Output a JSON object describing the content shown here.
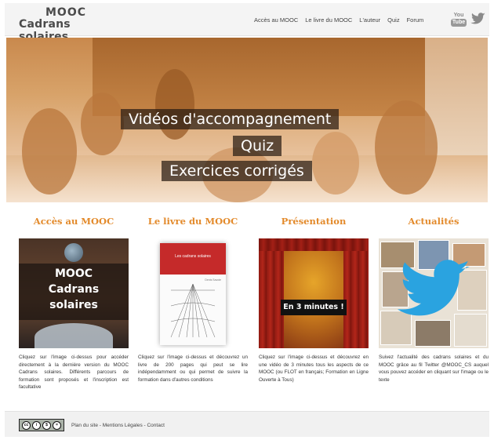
{
  "header": {
    "logo_top": "MOOC",
    "logo_name": "Cadrans solaires",
    "nav": [
      "Accès au MOOC",
      "Le livre du MOOC",
      "L'auteur",
      "Quiz",
      "Forum"
    ],
    "youtube_you": "You",
    "youtube_tube": "Tube"
  },
  "hero": {
    "lines": [
      "Vidéos d'accompagnement",
      "Quiz",
      "Exercices corrigés"
    ]
  },
  "columns": [
    {
      "title": "Accès au MOOC",
      "image_lines": [
        "MOOC",
        "Cadrans",
        "solaires"
      ],
      "text": "Cliquez sur l'image ci-dessus pour accéder directement à la dernière version du MOOC Cadrans solaires. Différents parcours de formation sont proposés et l'inscription est facultative"
    },
    {
      "title": "Le livre du MOOC",
      "book_title": "Les cadrans solaires",
      "book_author": "Denis Savoie",
      "text": "Cliquez sur l'image ci-dessus et découvrez un livre de 200 pages qui peut se lire indépendamment ou qui permet de suivre la formation dans d'autres conditions"
    },
    {
      "title": "Présentation",
      "image_label": "En 3 minutes !",
      "text": "Cliquez sur l'image ci-dessus et découvrez en une vidéo de 3 minutes tous les aspects de ce MOOC (ou FLOT en français; Formation en Ligne Ouverte à Tous)"
    },
    {
      "title": "Actualités",
      "text": "Suivez l'actualité des cadrans solaires et du MOOC grâce au fil Twitter @MOOC_CS auquel vous pouvez accéder en cliquant sur l'image ou le texte"
    }
  ],
  "footer": {
    "license_marks": [
      "cc",
      "i",
      "$",
      "="
    ],
    "links": [
      "Plan du site",
      "Mentions Légales",
      "Contact"
    ],
    "separator": " - "
  },
  "colors": {
    "accent": "#e38a2b",
    "header_bg": "#f4f4f4",
    "footer_bg": "#f1f1f1",
    "twitter_blue": "#2aa3e0"
  },
  "icons": [
    "youtube-icon",
    "twitter-icon",
    "creative-commons-icon"
  ]
}
